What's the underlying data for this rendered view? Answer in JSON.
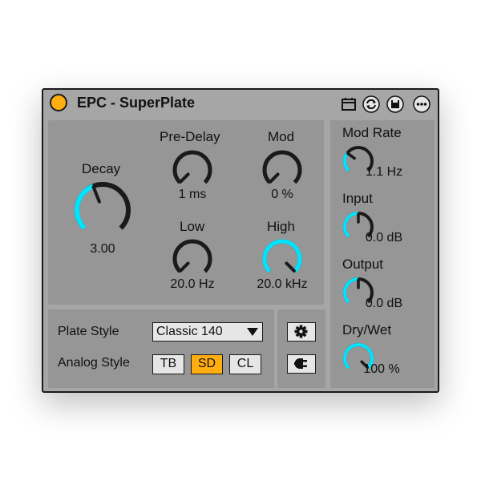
{
  "device": {
    "title": "EPC - SuperPlate",
    "accent_color": "#00e5ff",
    "power_color": "#ffae11",
    "header_icons": [
      "calendar-icon",
      "swap-icon",
      "save-icon",
      "more-icon"
    ]
  },
  "knobs": {
    "decay": {
      "label": "Decay",
      "value": "3.00",
      "fill": 0.42
    },
    "pre_delay": {
      "label": "Pre-Delay",
      "value": "1 ms",
      "fill": 0.0
    },
    "mod": {
      "label": "Mod",
      "value": "0 %",
      "fill": 0.0
    },
    "low": {
      "label": "Low",
      "value": "20.0 Hz",
      "fill": 0.0
    },
    "high": {
      "label": "High",
      "value": "20.0 kHz",
      "fill": 1.0
    },
    "mod_rate": {
      "label": "Mod Rate",
      "value": "1.1 Hz",
      "fill": 0.3
    },
    "input": {
      "label": "Input",
      "value": "0.0 dB",
      "fill": 0.5
    },
    "output": {
      "label": "Output",
      "value": "0.0 dB",
      "fill": 0.5
    },
    "dry_wet": {
      "label": "Dry/Wet",
      "value": "100 %",
      "fill": 1.0
    }
  },
  "plate_style": {
    "label": "Plate Style",
    "selected": "Classic 140"
  },
  "analog_style": {
    "label": "Analog Style",
    "options": [
      "TB",
      "SD",
      "CL"
    ],
    "active": "SD"
  },
  "side_buttons": [
    "gear-icon",
    "plug-icon"
  ]
}
